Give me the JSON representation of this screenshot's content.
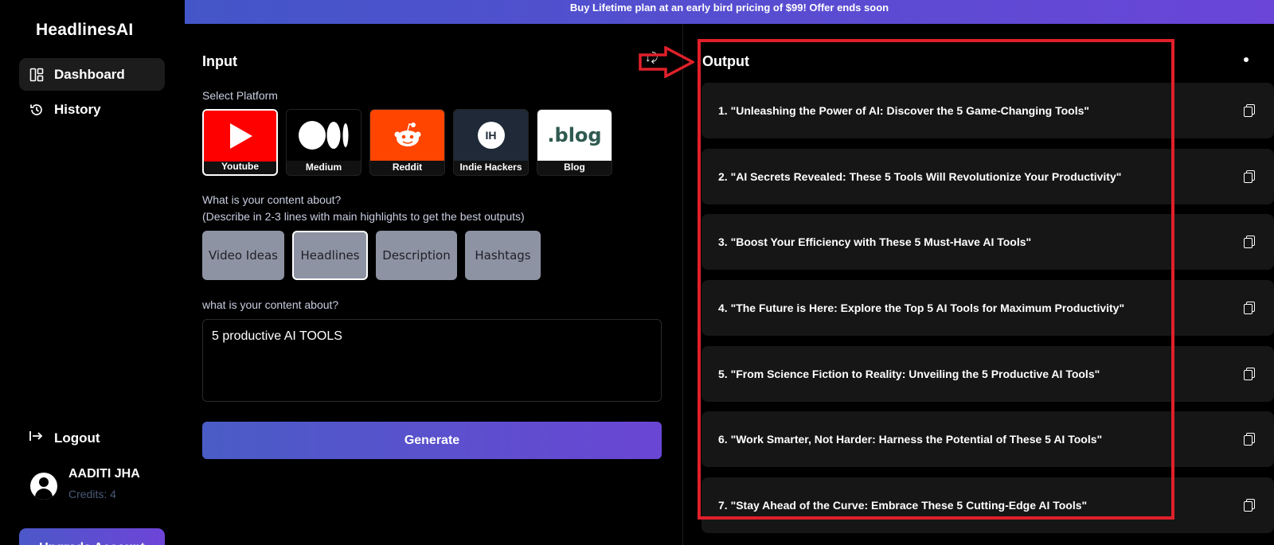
{
  "banner": {
    "text": "Buy Lifetime plan at an early bird pricing of $99! Offer ends soon"
  },
  "sidebar": {
    "logo": "HeadlinesAI",
    "items": [
      {
        "label": "Dashboard",
        "icon": "dashboard-icon",
        "active": true
      },
      {
        "label": "History",
        "icon": "history-icon",
        "active": false
      }
    ],
    "logout_label": "Logout",
    "user": {
      "name": "AADITI JHA",
      "credits": "Credits: 4"
    },
    "upgrade_label": "Upgrade Account"
  },
  "input": {
    "title": "Input",
    "select_platform_label": "Select Platform",
    "platforms": [
      {
        "name": "Youtube",
        "selected": true
      },
      {
        "name": "Medium",
        "selected": false
      },
      {
        "name": "Reddit",
        "selected": false
      },
      {
        "name": "Indie Hackers",
        "selected": false,
        "mark": "IH"
      },
      {
        "name": "Blog",
        "selected": false,
        "mark": ".blog"
      }
    ],
    "content_question": "What is your content about?",
    "content_hint": "(Describe in 2-3 lines with main highlights to get the best outputs)",
    "types": [
      {
        "label": "Video Ideas",
        "selected": false
      },
      {
        "label": "Headlines",
        "selected": true
      },
      {
        "label": "Description",
        "selected": false
      },
      {
        "label": "Hashtags",
        "selected": false
      }
    ],
    "content_label": "what is your content about?",
    "content_value": "5 productive AI TOOLS",
    "generate_label": "Generate"
  },
  "output": {
    "title": "Output",
    "items": [
      "1. \"Unleashing the Power of AI: Discover the 5 Game-Changing Tools\"",
      "2. \"AI Secrets Revealed: These 5 Tools Will Revolutionize Your Productivity\"",
      "3. \"Boost Your Efficiency with These 5 Must-Have AI Tools\"",
      "4. \"The Future is Here: Explore the Top 5 AI Tools for Maximum Productivity\"",
      "5. \"From Science Fiction to Reality: Unveiling the 5 Productive AI Tools\"",
      "6. \"Work Smarter, Not Harder: Harness the Potential of These 5 AI Tools\"",
      "7. \"Stay Ahead of the Curve: Embrace These 5 Cutting-Edge AI Tools\""
    ]
  },
  "colors": {
    "accent_start": "#4356c8",
    "accent_end": "#6a45d8",
    "annotation": "#e0202a",
    "youtube": "#ff0000",
    "reddit": "#ff4500"
  }
}
